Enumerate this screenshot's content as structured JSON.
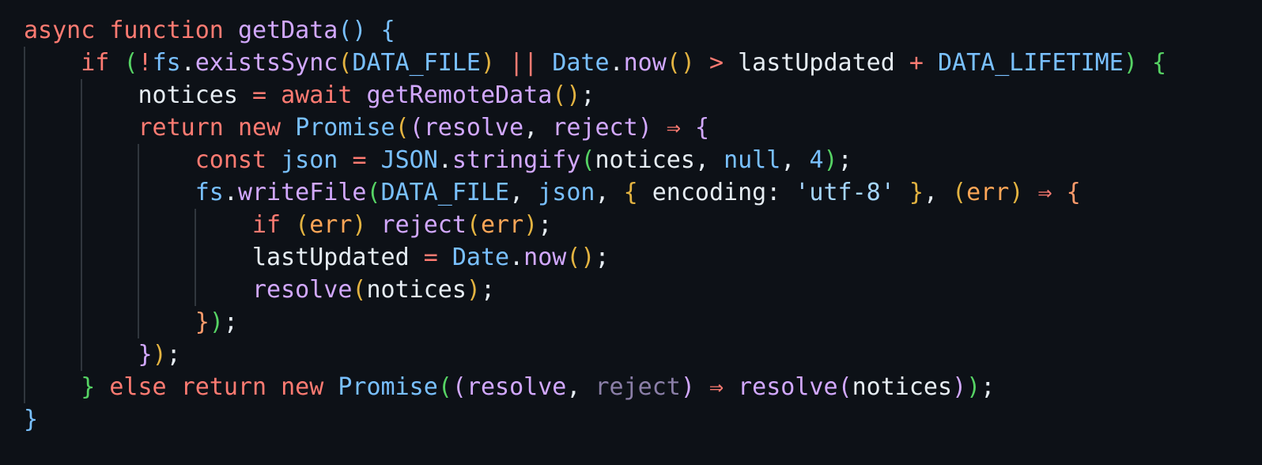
{
  "code": {
    "lines": [
      [
        [
          "kw",
          "async"
        ],
        [
          "plain",
          " "
        ],
        [
          "kw",
          "function"
        ],
        [
          "plain",
          " "
        ],
        [
          "fn",
          "getData"
        ],
        [
          "b1",
          "()"
        ],
        [
          "plain",
          " "
        ],
        [
          "b1",
          "{"
        ]
      ],
      [
        [
          "plain",
          "    "
        ],
        [
          "kw",
          "if"
        ],
        [
          "plain",
          " "
        ],
        [
          "b2",
          "("
        ],
        [
          "op",
          "!"
        ],
        [
          "var",
          "fs"
        ],
        [
          "plain",
          "."
        ],
        [
          "fn",
          "existsSync"
        ],
        [
          "b3",
          "("
        ],
        [
          "var",
          "DATA_FILE"
        ],
        [
          "b3",
          ")"
        ],
        [
          "plain",
          " "
        ],
        [
          "op",
          "||"
        ],
        [
          "plain",
          " "
        ],
        [
          "var",
          "Date"
        ],
        [
          "plain",
          "."
        ],
        [
          "fn",
          "now"
        ],
        [
          "b3",
          "()"
        ],
        [
          "plain",
          " "
        ],
        [
          "op",
          ">"
        ],
        [
          "plain",
          " lastUpdated "
        ],
        [
          "op",
          "+"
        ],
        [
          "plain",
          " "
        ],
        [
          "var",
          "DATA_LIFETIME"
        ],
        [
          "b2",
          ")"
        ],
        [
          "plain",
          " "
        ],
        [
          "b2",
          "{"
        ]
      ],
      [
        [
          "plain",
          "        notices "
        ],
        [
          "op",
          "="
        ],
        [
          "plain",
          " "
        ],
        [
          "kw",
          "await"
        ],
        [
          "plain",
          " "
        ],
        [
          "fn",
          "getRemoteData"
        ],
        [
          "b3",
          "()"
        ],
        [
          "plain",
          ";"
        ]
      ],
      [
        [
          "plain",
          "        "
        ],
        [
          "kw",
          "return"
        ],
        [
          "plain",
          " "
        ],
        [
          "kw",
          "new"
        ],
        [
          "plain",
          " "
        ],
        [
          "var",
          "Promise"
        ],
        [
          "b3",
          "("
        ],
        [
          "b5",
          "("
        ],
        [
          "fn",
          "resolve"
        ],
        [
          "plain",
          ", "
        ],
        [
          "fn",
          "reject"
        ],
        [
          "b5",
          ")"
        ],
        [
          "plain",
          " "
        ],
        [
          "op",
          "⇒"
        ],
        [
          "plain",
          " "
        ],
        [
          "b5",
          "{"
        ]
      ],
      [
        [
          "plain",
          "            "
        ],
        [
          "kw",
          "const"
        ],
        [
          "plain",
          " "
        ],
        [
          "var",
          "json"
        ],
        [
          "plain",
          " "
        ],
        [
          "op",
          "="
        ],
        [
          "plain",
          " "
        ],
        [
          "var",
          "JSON"
        ],
        [
          "plain",
          "."
        ],
        [
          "fn",
          "stringify"
        ],
        [
          "b2",
          "("
        ],
        [
          "plain",
          "notices, "
        ],
        [
          "num",
          "null"
        ],
        [
          "plain",
          ", "
        ],
        [
          "num",
          "4"
        ],
        [
          "b2",
          ")"
        ],
        [
          "plain",
          ";"
        ]
      ],
      [
        [
          "plain",
          "            "
        ],
        [
          "var",
          "fs"
        ],
        [
          "plain",
          "."
        ],
        [
          "fn",
          "writeFile"
        ],
        [
          "b2",
          "("
        ],
        [
          "var",
          "DATA_FILE"
        ],
        [
          "plain",
          ", "
        ],
        [
          "var",
          "json"
        ],
        [
          "plain",
          ", "
        ],
        [
          "b3",
          "{"
        ],
        [
          "plain",
          " encoding: "
        ],
        [
          "str",
          "'utf-8'"
        ],
        [
          "plain",
          " "
        ],
        [
          "b3",
          "}"
        ],
        [
          "plain",
          ", "
        ],
        [
          "b3",
          "("
        ],
        [
          "param",
          "err"
        ],
        [
          "b3",
          ")"
        ],
        [
          "plain",
          " "
        ],
        [
          "op",
          "⇒"
        ],
        [
          "plain",
          " "
        ],
        [
          "b4",
          "{"
        ]
      ],
      [
        [
          "plain",
          "                "
        ],
        [
          "kw",
          "if"
        ],
        [
          "plain",
          " "
        ],
        [
          "b3",
          "("
        ],
        [
          "param",
          "err"
        ],
        [
          "b3",
          ")"
        ],
        [
          "plain",
          " "
        ],
        [
          "fn",
          "reject"
        ],
        [
          "b3",
          "("
        ],
        [
          "param",
          "err"
        ],
        [
          "b3",
          ")"
        ],
        [
          "plain",
          ";"
        ]
      ],
      [
        [
          "plain",
          "                lastUpdated "
        ],
        [
          "op",
          "="
        ],
        [
          "plain",
          " "
        ],
        [
          "var",
          "Date"
        ],
        [
          "plain",
          "."
        ],
        [
          "fn",
          "now"
        ],
        [
          "b3",
          "()"
        ],
        [
          "plain",
          ";"
        ]
      ],
      [
        [
          "plain",
          "                "
        ],
        [
          "fn",
          "resolve"
        ],
        [
          "b3",
          "("
        ],
        [
          "plain",
          "notices"
        ],
        [
          "b3",
          ")"
        ],
        [
          "plain",
          ";"
        ]
      ],
      [
        [
          "plain",
          "            "
        ],
        [
          "b4",
          "}"
        ],
        [
          "b2",
          ")"
        ],
        [
          "plain",
          ";"
        ]
      ],
      [
        [
          "plain",
          "        "
        ],
        [
          "b5",
          "}"
        ],
        [
          "b3",
          ")"
        ],
        [
          "plain",
          ";"
        ]
      ],
      [
        [
          "plain",
          "    "
        ],
        [
          "b2",
          "}"
        ],
        [
          "plain",
          " "
        ],
        [
          "kw",
          "else"
        ],
        [
          "plain",
          " "
        ],
        [
          "kw",
          "return"
        ],
        [
          "plain",
          " "
        ],
        [
          "kw",
          "new"
        ],
        [
          "plain",
          " "
        ],
        [
          "var",
          "Promise"
        ],
        [
          "b2",
          "("
        ],
        [
          "b5",
          "("
        ],
        [
          "fn",
          "resolve"
        ],
        [
          "plain",
          ", "
        ],
        [
          "dim",
          "reject"
        ],
        [
          "b5",
          ")"
        ],
        [
          "plain",
          " "
        ],
        [
          "op",
          "⇒"
        ],
        [
          "plain",
          " "
        ],
        [
          "fn",
          "resolve"
        ],
        [
          "b5",
          "("
        ],
        [
          "plain",
          "notices"
        ],
        [
          "b5",
          ")"
        ],
        [
          "b2",
          ")"
        ],
        [
          "plain",
          ";"
        ]
      ],
      [
        [
          "b1",
          "}"
        ]
      ]
    ]
  },
  "colors": {
    "background": "#0d1117",
    "keyword": "#ff7b72",
    "function": "#d2a8ff",
    "variable": "#79c0ff",
    "text": "#e6edf3"
  }
}
